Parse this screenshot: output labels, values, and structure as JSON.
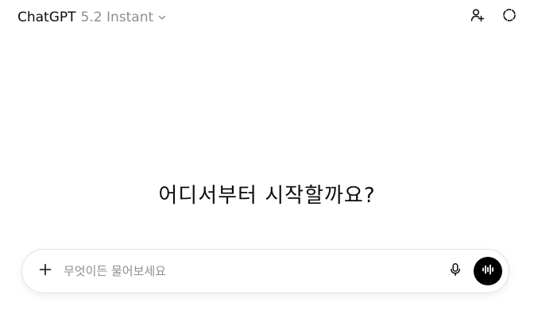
{
  "header": {
    "model_name": "ChatGPT",
    "model_version": "5.2 Instant",
    "icons": {
      "switcher": "chevron-down-icon",
      "add_person": "add-person-icon",
      "temporary_chat": "temporary-chat-icon"
    }
  },
  "main": {
    "headline": "어디서부터 시작할까요?"
  },
  "composer": {
    "placeholder": "무엇이든 물어보세요",
    "value": "",
    "icons": {
      "attach": "plus-icon",
      "dictate": "microphone-icon",
      "voice_mode": "voice-waveform-icon"
    }
  },
  "colors": {
    "text_primary": "#0d0d0d",
    "text_secondary": "#8f8f8f",
    "composer_border": "#e3e3e3",
    "voice_button": "#000000"
  }
}
